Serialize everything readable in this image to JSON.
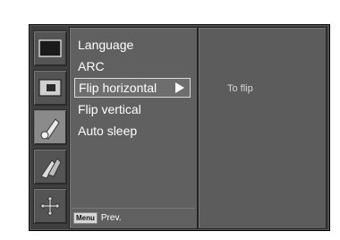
{
  "osd": {
    "icons": [
      {
        "name": "picture-icon",
        "selected": false
      },
      {
        "name": "screen-icon",
        "selected": false
      },
      {
        "name": "special-icon",
        "selected": true
      },
      {
        "name": "setup-icon",
        "selected": false
      },
      {
        "name": "position-icon",
        "selected": false
      }
    ],
    "menu": {
      "items": [
        {
          "label": "Language"
        },
        {
          "label": "ARC"
        },
        {
          "label": "Flip horizontal"
        },
        {
          "label": "Flip vertical"
        },
        {
          "label": "Auto sleep"
        }
      ],
      "highlighted_item": "Flip horizontal"
    },
    "footer": {
      "key_label": "Menu",
      "action_label": "Prev."
    },
    "description": {
      "text": "To flip"
    },
    "colors": {
      "frame": "#3e3e3e",
      "menu_bg": "#606060",
      "highlight_border": "#dcdcdc",
      "text": "#ffffff"
    }
  }
}
